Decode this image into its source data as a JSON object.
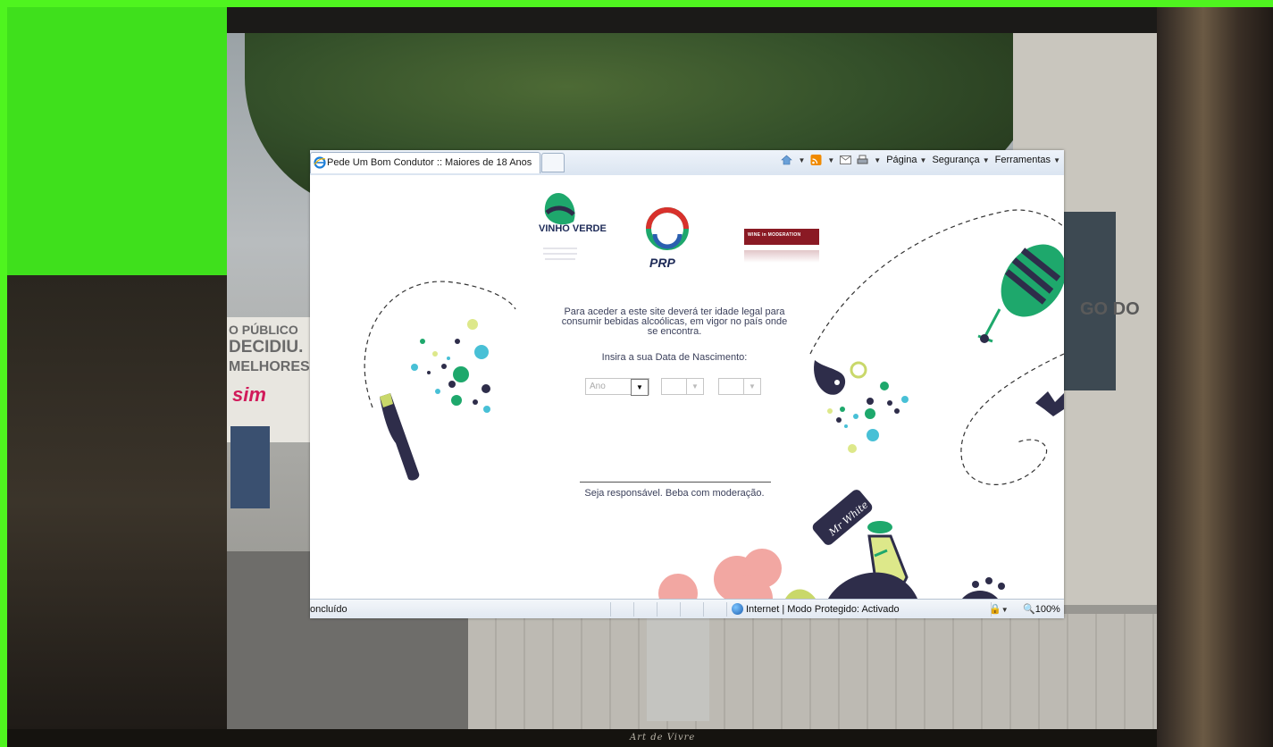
{
  "browser": {
    "tab_title": "Pede Um Bom Condutor :: Maiores de 18 Anos",
    "command_bar": {
      "page_label": "Página",
      "security_label": "Segurança",
      "tools_label": "Ferramentas"
    },
    "status": {
      "text": "oncluído",
      "zone": "Internet | Modo Protegido: Activado",
      "zoom": "100%"
    }
  },
  "page": {
    "logos": {
      "vinho_verde": "VINHO VERDE",
      "prp": "PRP",
      "wine_moderation": "WINE in MODERATION"
    },
    "intro": "Para aceder a este site deverá ter idade legal para consumir bebidas alcoólicas, em vigor no país onde se encontra.",
    "dob_label": "Insira a sua Data de Nascimento:",
    "year_select": {
      "value": "Ano"
    },
    "month_select": {
      "value": ""
    },
    "day_select": {
      "value": ""
    },
    "footer": "Seja responsável. Beba com moderação.",
    "character_label": "Mr White"
  },
  "photo": {
    "billboard_lines": [
      "O PÚBLICO",
      "DECIDIU.",
      "MELHORES."
    ],
    "billboard_brand": "sim",
    "building_sign": "GO DO"
  },
  "caption": "Art de Vivre"
}
